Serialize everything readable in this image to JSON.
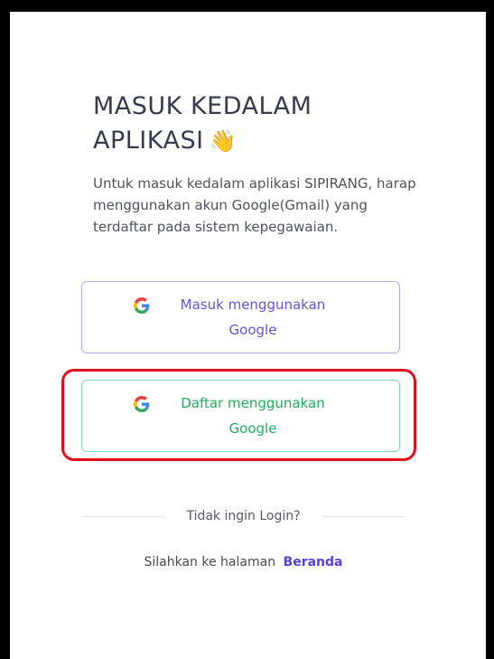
{
  "login": {
    "title_line1": "MASUK KEDALAM",
    "title_line2": "APLIKASI",
    "title_emoji": "👋",
    "description": "Untuk masuk kedalam aplikasi SIPIRANG, harap menggunakan akun Google(Gmail) yang terdaftar pada sistem kepegawaian.",
    "login_button": {
      "icon": "google-icon",
      "label": "Masuk menggunakan Google"
    },
    "register_button": {
      "icon": "google-icon",
      "label": "Daftar menggunakan Google"
    },
    "divider_text": "Tidak ingin Login?",
    "footer_text": "Silahkan ke halaman",
    "footer_link": "Beranda"
  },
  "colors": {
    "login_accent": "#6a50e0",
    "register_accent": "#1fae5f",
    "highlight": "#e0101b"
  }
}
